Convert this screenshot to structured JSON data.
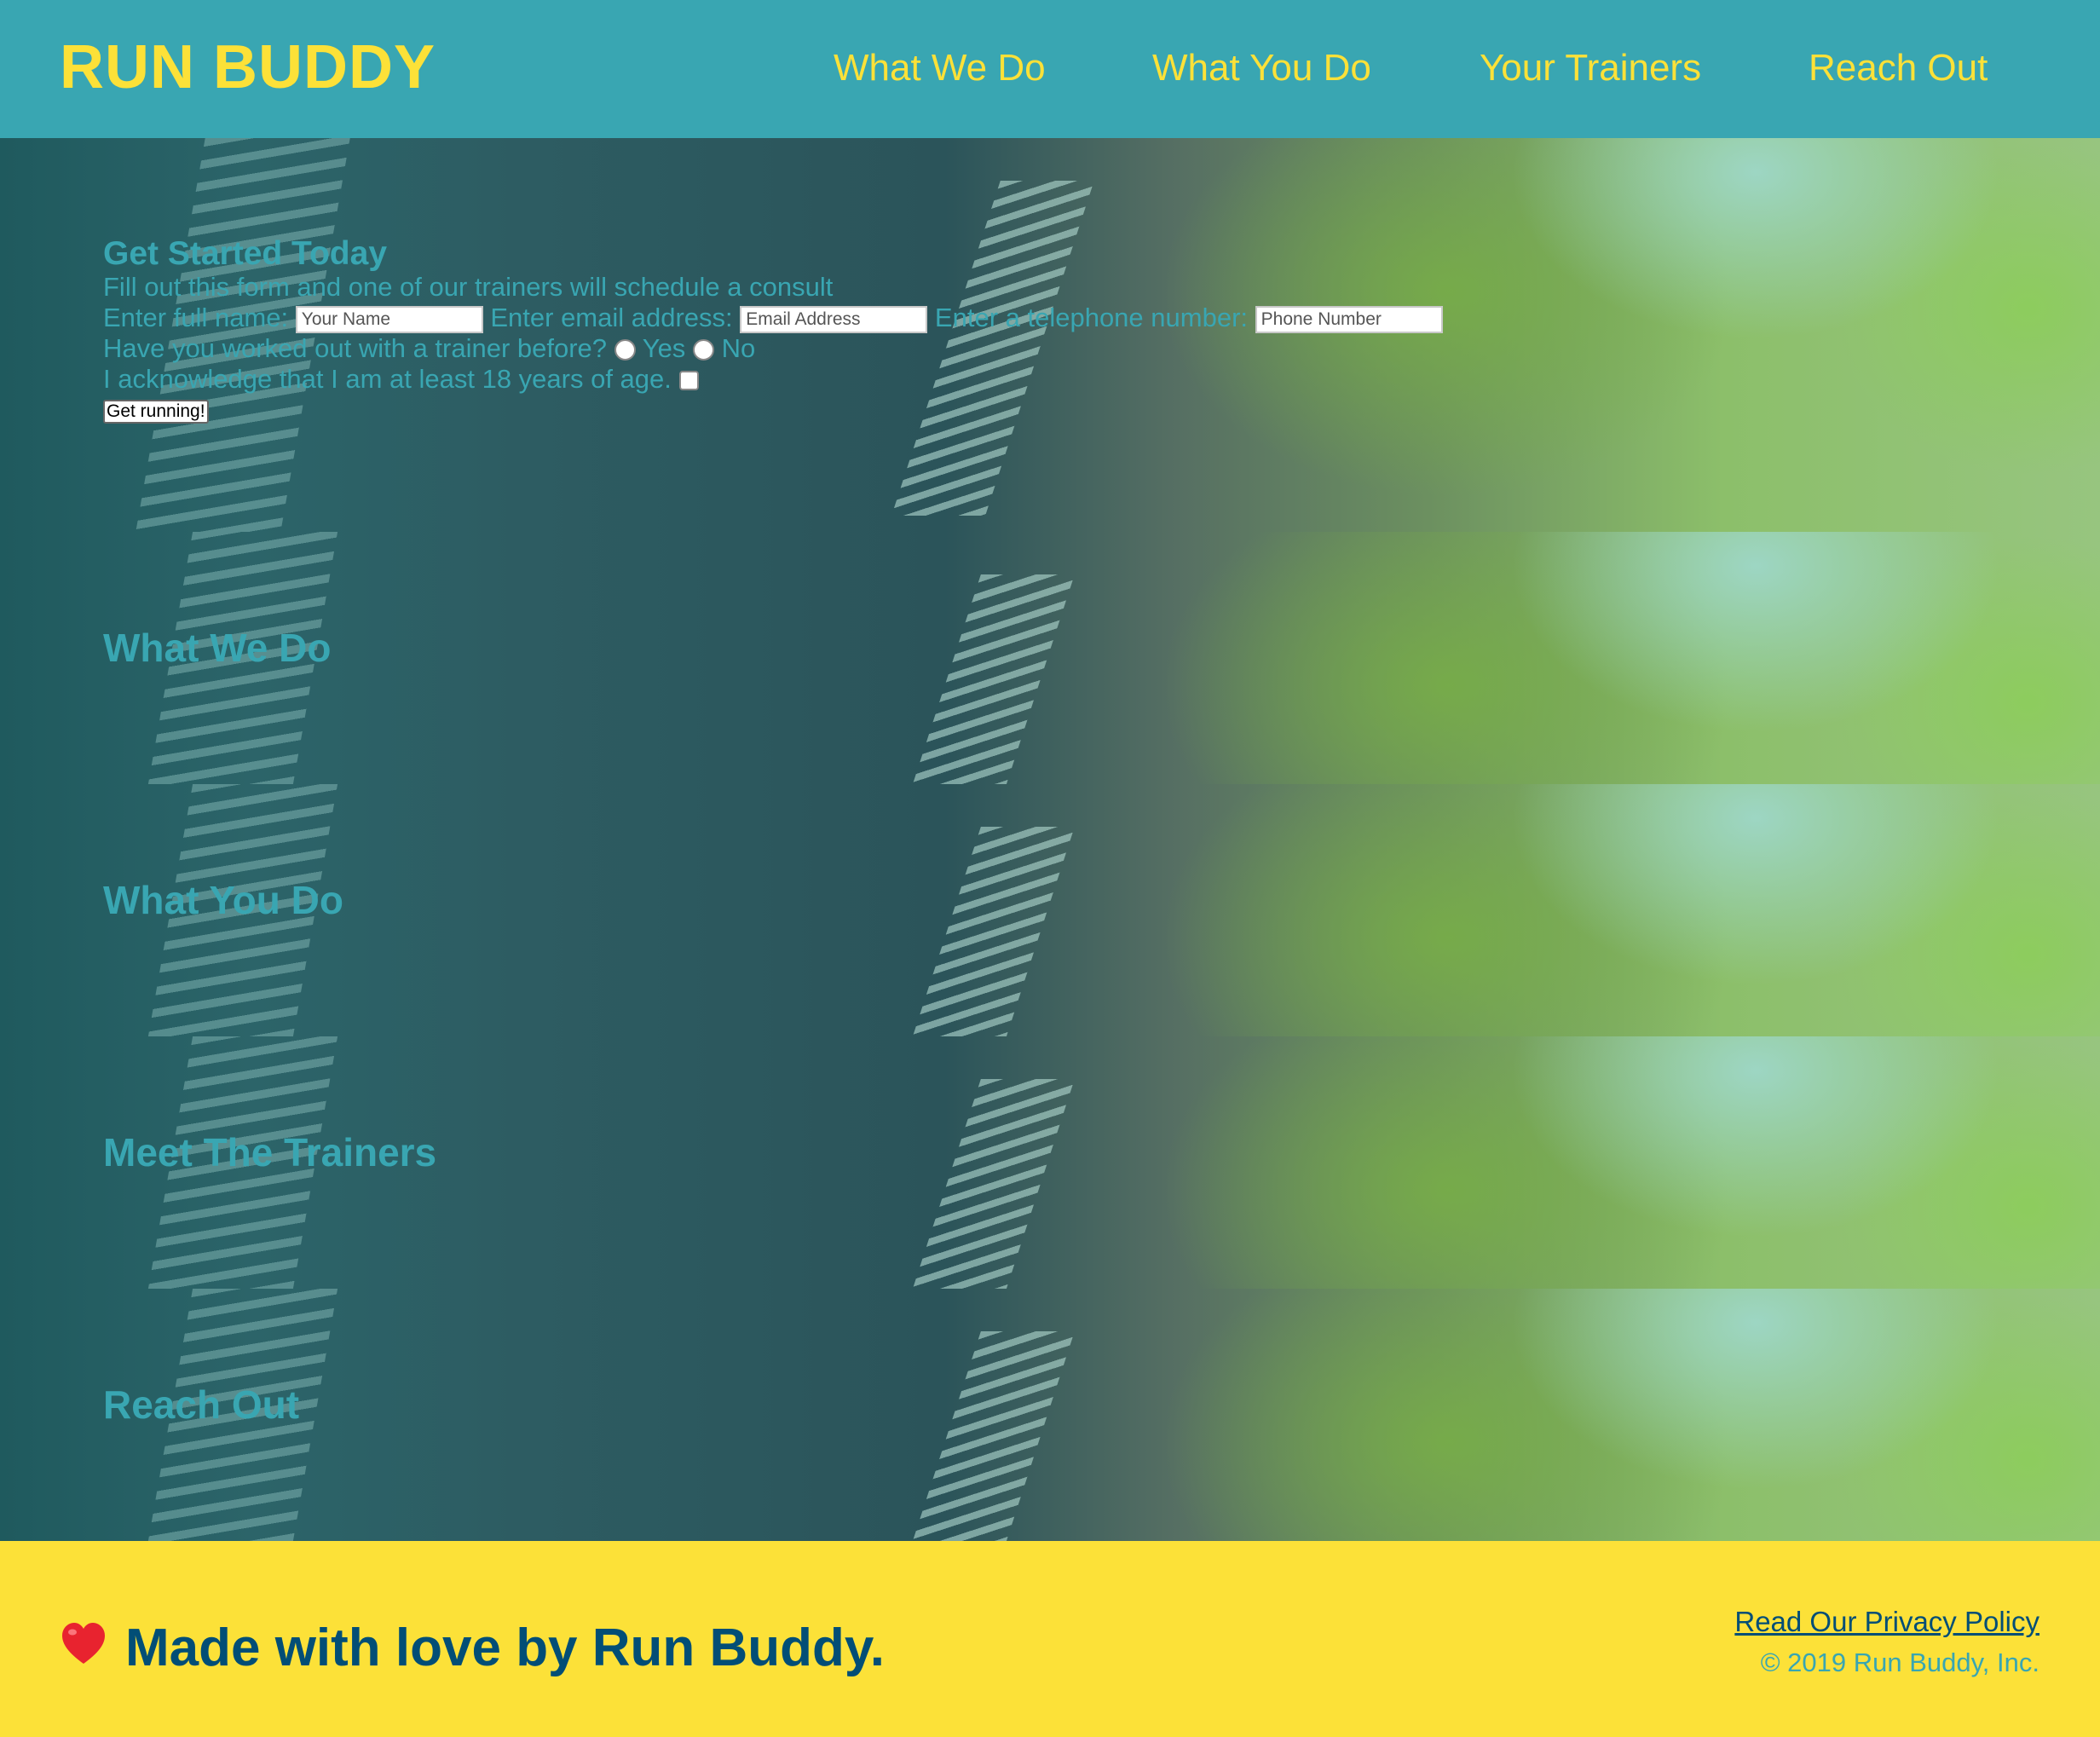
{
  "header": {
    "logo": "RUN BUDDY",
    "nav": [
      "What We Do",
      "What You Do",
      "Your Trainers",
      "Reach Out"
    ]
  },
  "form": {
    "title": "Get Started Today",
    "subtitle": "Fill out this form and one of our trainers will schedule a consult",
    "name_label": "Enter full name:",
    "name_placeholder": "Your Name",
    "email_label": "Enter email address:",
    "email_placeholder": "Email Address",
    "phone_label": "Enter a telephone number:",
    "phone_placeholder": "Phone Number",
    "trainer_question": "Have you worked out with a trainer before?",
    "yes_label": "Yes",
    "no_label": "No",
    "acknowledge": "I acknowledge that I am at least 18 years of age.",
    "submit_label": "Get running!"
  },
  "sections": [
    "What We Do",
    "What You Do",
    "Meet The Trainers",
    "Reach Out"
  ],
  "footer": {
    "message": "Made with love by Run Buddy.",
    "privacy_link": "Read Our Privacy Policy",
    "copyright": "© 2019 Run Buddy, Inc."
  },
  "colors": {
    "primary": "#39a6b2",
    "accent": "#fce138",
    "dark": "#024e76"
  }
}
